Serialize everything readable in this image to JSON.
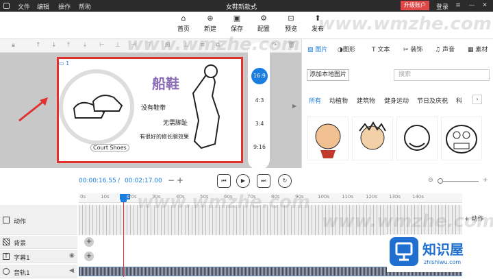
{
  "menubar": {
    "menus": [
      "文件",
      "编辑",
      "操作",
      "帮助"
    ],
    "title": "女鞋新款式",
    "upgrade": "升级账户",
    "login": "登录"
  },
  "toolbar": {
    "home": "首页",
    "new": "新建",
    "save": "保存",
    "config": "配置",
    "preview": "预览",
    "publish": "发布"
  },
  "canvas": {
    "scene_label": "1",
    "title_text": "船鞋",
    "line1": "没有鞋带",
    "line2": "无需脚趾",
    "line3": "有很好的修长腿效果",
    "caption": "Court Shoes"
  },
  "ratios": [
    "16:9",
    "4:3",
    "3:4",
    "9:16"
  ],
  "active_ratio": "16:9",
  "right_panel": {
    "tabs": [
      "图片",
      "图形",
      "文本",
      "装饰",
      "声音",
      "素材"
    ],
    "active_tab": "图片",
    "add_local": "添加本地图片",
    "search_placeholder": "搜索",
    "categories": [
      "所有",
      "动植物",
      "建筑物",
      "健身运动",
      "节日及庆祝",
      "科"
    ],
    "active_category": "所有"
  },
  "playback": {
    "current_time": "00:00:16.55",
    "separator": "/",
    "total_time": "00:02:17.00",
    "minus": "−",
    "plus": "+"
  },
  "ruler": {
    "ticks": [
      "0s",
      "10s",
      "16s",
      "20s",
      "30s",
      "40s",
      "50s",
      "60s",
      "70s",
      "80s",
      "90s",
      "100s",
      "110s",
      "120s",
      "130s",
      "140s"
    ]
  },
  "tracks": {
    "motion": "动作",
    "background": "背景",
    "subtitle": "字幕1",
    "audio": "音轨1",
    "add_motion": "+ 动作"
  },
  "watermark": "www.wmzhe.com",
  "brand": {
    "name": "知识屋",
    "url": "zhishiwu.com",
    "color": "#1e6fd0"
  },
  "colors": {
    "accent": "#1a7de0",
    "highlight_red": "#e03030"
  }
}
